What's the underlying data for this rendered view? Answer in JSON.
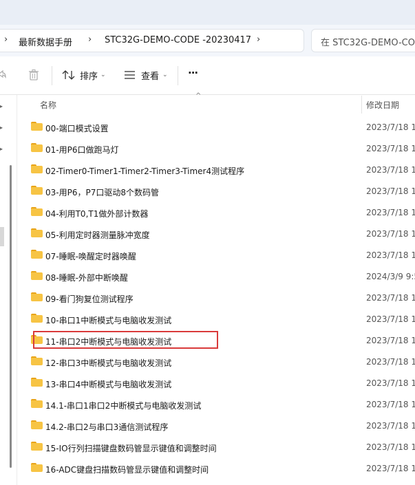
{
  "breadcrumb": {
    "items": [
      "最新数据手册",
      "STC32G-DEMO-CODE -20230417"
    ],
    "search_placeholder": "在 STC32G-DEMO-CO"
  },
  "toolbar": {
    "sort_label": "排序",
    "view_label": "查看",
    "more_label": "···"
  },
  "columns": {
    "name": "名称",
    "modified": "修改日期"
  },
  "files": [
    {
      "name": "00-端口模式设置",
      "date": "2023/7/18 1"
    },
    {
      "name": "01-用P6口做跑马灯",
      "date": "2023/7/18 1"
    },
    {
      "name": "02-Timer0-Timer1-Timer2-Timer3-Timer4测试程序",
      "date": "2023/7/18 1"
    },
    {
      "name": "03-用P6，P7口驱动8个数码管",
      "date": "2023/7/18 1"
    },
    {
      "name": "04-利用T0,T1做外部计数器",
      "date": "2023/7/18 1"
    },
    {
      "name": "05-利用定时器测量脉冲宽度",
      "date": "2023/7/18 1"
    },
    {
      "name": "07-睡眠-唤醒定时器唤醒",
      "date": "2023/7/18 1"
    },
    {
      "name": "08-睡眠-外部中断唤醒",
      "date": "2024/3/9 9:5"
    },
    {
      "name": "09-看门狗复位测试程序",
      "date": "2023/7/18 1"
    },
    {
      "name": "10-串口1中断模式与电脑收发测试",
      "date": "2023/7/18 1"
    },
    {
      "name": "11-串口2中断模式与电脑收发测试",
      "date": "2023/7/18 1"
    },
    {
      "name": "12-串口3中断模式与电脑收发测试",
      "date": "2023/7/18 1"
    },
    {
      "name": "13-串口4中断模式与电脑收发测试",
      "date": "2023/7/18 1"
    },
    {
      "name": "14.1-串口1串口2中断模式与电脑收发测试",
      "date": "2023/7/18 1"
    },
    {
      "name": "14.2-串口2与串口3通信测试程序",
      "date": "2023/7/18 1"
    },
    {
      "name": "15-IO行列扫描键盘数码管显示键值和调整时间",
      "date": "2023/7/18 1"
    },
    {
      "name": "16-ADC键盘扫描数码管显示键值和调整时间",
      "date": "2023/7/18 1"
    }
  ],
  "highlighted_index": 10,
  "colors": {
    "highlight": "#d93a3a",
    "folder": "#f7c444"
  }
}
